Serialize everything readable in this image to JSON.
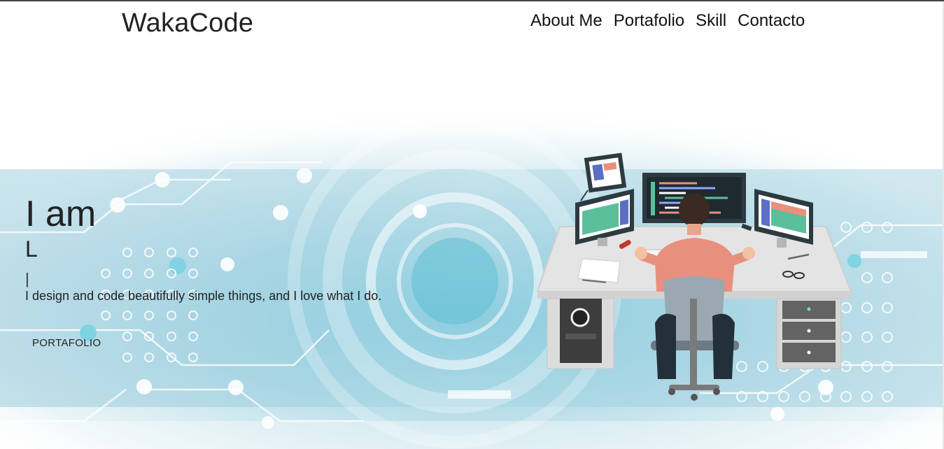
{
  "brand": {
    "name": "WakaCode"
  },
  "nav": {
    "items": [
      {
        "label": "About Me"
      },
      {
        "label": "Portafolio"
      },
      {
        "label": "Skill"
      },
      {
        "label": "Contacto"
      }
    ]
  },
  "hero": {
    "greeting": "I am",
    "typed_text": "L",
    "typing_cursor": "|",
    "tagline": "I design and code beautifully simple things, and I love what I do.",
    "cta_label": "PORTAFOLIO"
  },
  "colors": {
    "accent_teal": "#5aa9c6",
    "text": "#222222",
    "monitor_frame": "#2d3a40",
    "shirt": "#e8907e"
  }
}
